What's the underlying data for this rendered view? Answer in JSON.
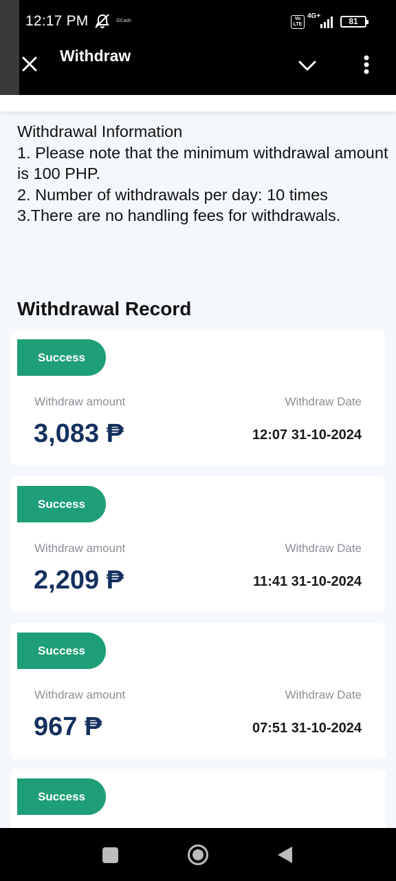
{
  "status_bar": {
    "time": "12:17 PM",
    "app_label": "GCash",
    "volte": "Vo LTE",
    "network": "4G+",
    "battery": "81"
  },
  "app_bar": {
    "title": "Withdraw",
    "icons": [
      "close-icon",
      "chevron-down-icon",
      "more-vertical-icon"
    ]
  },
  "info": {
    "lines": [
      "Withdrawal Information",
      "1. Please note that the minimum withdrawal amount is 100 PHP.",
      "2. Number of withdrawals per day: 10 times",
      "3.There are no handling fees for withdrawals."
    ]
  },
  "records_section": {
    "title": "Withdrawal Record",
    "amount_label": "Withdraw amount",
    "date_label": "Withdraw Date",
    "items": [
      {
        "status": "Success",
        "amount": "3,083 ₱",
        "date": "12:07 31-10-2024"
      },
      {
        "status": "Success",
        "amount": "2,209 ₱",
        "date": "11:41 31-10-2024"
      },
      {
        "status": "Success",
        "amount": "967 ₱",
        "date": "07:51 31-10-2024"
      },
      {
        "status": "Success"
      }
    ]
  },
  "colors": {
    "badge": "#1e9f77",
    "amount": "#14305e",
    "background": "#f4f8fc"
  }
}
